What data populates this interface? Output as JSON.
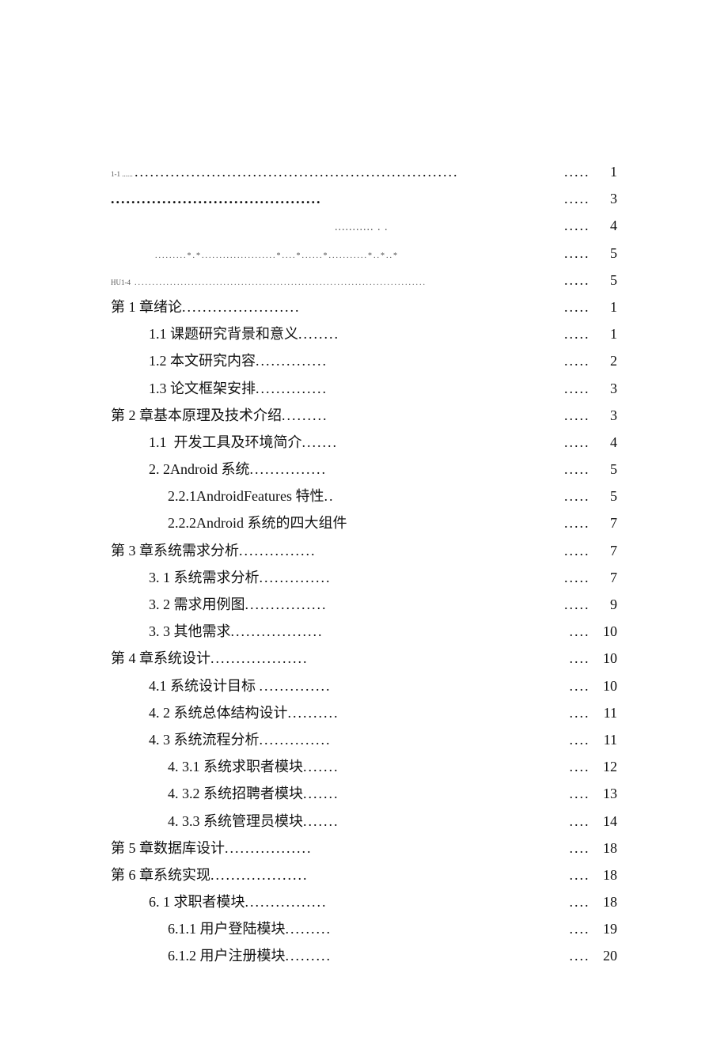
{
  "toc": [
    {
      "level": 0,
      "label_style": "tiny",
      "label": "1-1 ......",
      "leader": "...............................................................",
      "page": "1"
    },
    {
      "level": 0,
      "label": "",
      "leader": ".........................................",
      "leader_bold": true,
      "page": "3"
    },
    {
      "level": 0,
      "label": "",
      "leader": "                                                               ........... . .",
      "leader_bold": true,
      "page": "4",
      "sub": true
    },
    {
      "level": 0,
      "label": "",
      "indent_extra": 56,
      "leader": ".........*.*.....................*....*......*...........*..*..*",
      "page": "5",
      "sub": true
    },
    {
      "level": 0,
      "label_style": "tiny",
      "label": "HU1-4",
      "leader": "..................................................................................",
      "page": "5",
      "sub": true
    },
    {
      "level": 0,
      "label": "第 1 章绪论",
      "leader": ".......................",
      "page": "1"
    },
    {
      "level": 1,
      "label": "1.1 课题研究背景和意义",
      "leader": "........",
      "page": "1"
    },
    {
      "level": 1,
      "label": "1.2 本文研究内容",
      "leader": "..............",
      "page": "2"
    },
    {
      "level": 1,
      "label": "1.3 论文框架安排",
      "leader": "..............",
      "page": "3"
    },
    {
      "level": 0,
      "label": "第 2 章基本原理及技术介绍",
      "leader": ".........",
      "page": "3"
    },
    {
      "level": 1,
      "label": "1.1  开发工具及环境简介",
      "leader": ".......",
      "page": "4"
    },
    {
      "level": 1,
      "label": "2. 2Android 系统",
      "leader": "...............",
      "page": "5"
    },
    {
      "level": 2,
      "label": "2.2.1AndroidFeatures 特性",
      "leader": "..",
      "page": "5"
    },
    {
      "level": 2,
      "label": "2.2.2Android 系统的四大组件",
      "leader": "",
      "page": "7"
    },
    {
      "level": 0,
      "label": "第 3 章系统需求分析",
      "leader": "...............",
      "page": "7"
    },
    {
      "level": 1,
      "label": "3. 1 系统需求分析",
      "leader": "..............",
      "page": "7"
    },
    {
      "level": 1,
      "label": "3. 2 需求用例图",
      "leader": "................",
      "page": "9"
    },
    {
      "level": 1,
      "label": "3. 3 其他需求",
      "leader": "..................",
      "page": "10"
    },
    {
      "level": 0,
      "label": "第 4 章系统设计",
      "leader": "...................",
      "page": "10"
    },
    {
      "level": 1,
      "label": "4.1 系统设计目标 ",
      "leader": "..............",
      "page": "10"
    },
    {
      "level": 1,
      "label": "4. 2 系统总体结构设计",
      "leader": "..........",
      "page": "11"
    },
    {
      "level": 1,
      "label": "4. 3 系统流程分析",
      "leader": "..............",
      "page": "11"
    },
    {
      "level": 2,
      "label": "4. 3.1 系统求职者模块",
      "leader": ".......",
      "page": "12"
    },
    {
      "level": 2,
      "label": "4. 3.2 系统招聘者模块",
      "leader": ".......",
      "page": "13"
    },
    {
      "level": 2,
      "label": "4. 3.3 系统管理员模块",
      "leader": ".......",
      "page": "14"
    },
    {
      "level": 0,
      "label": "第 5 章数据库设计",
      "leader": ".................",
      "page": "18"
    },
    {
      "level": 0,
      "label": "第 6 章系统实现",
      "leader": "...................",
      "page": "18"
    },
    {
      "level": 1,
      "label": "6. 1 求职者模块",
      "leader": "................",
      "page": "18"
    },
    {
      "level": 2,
      "label": "6.1.1 用户登陆模块",
      "leader": ".........",
      "page": "19"
    },
    {
      "level": 2,
      "label": "6.1.2 用户注册模块",
      "leader": ".........",
      "page": "20"
    }
  ]
}
